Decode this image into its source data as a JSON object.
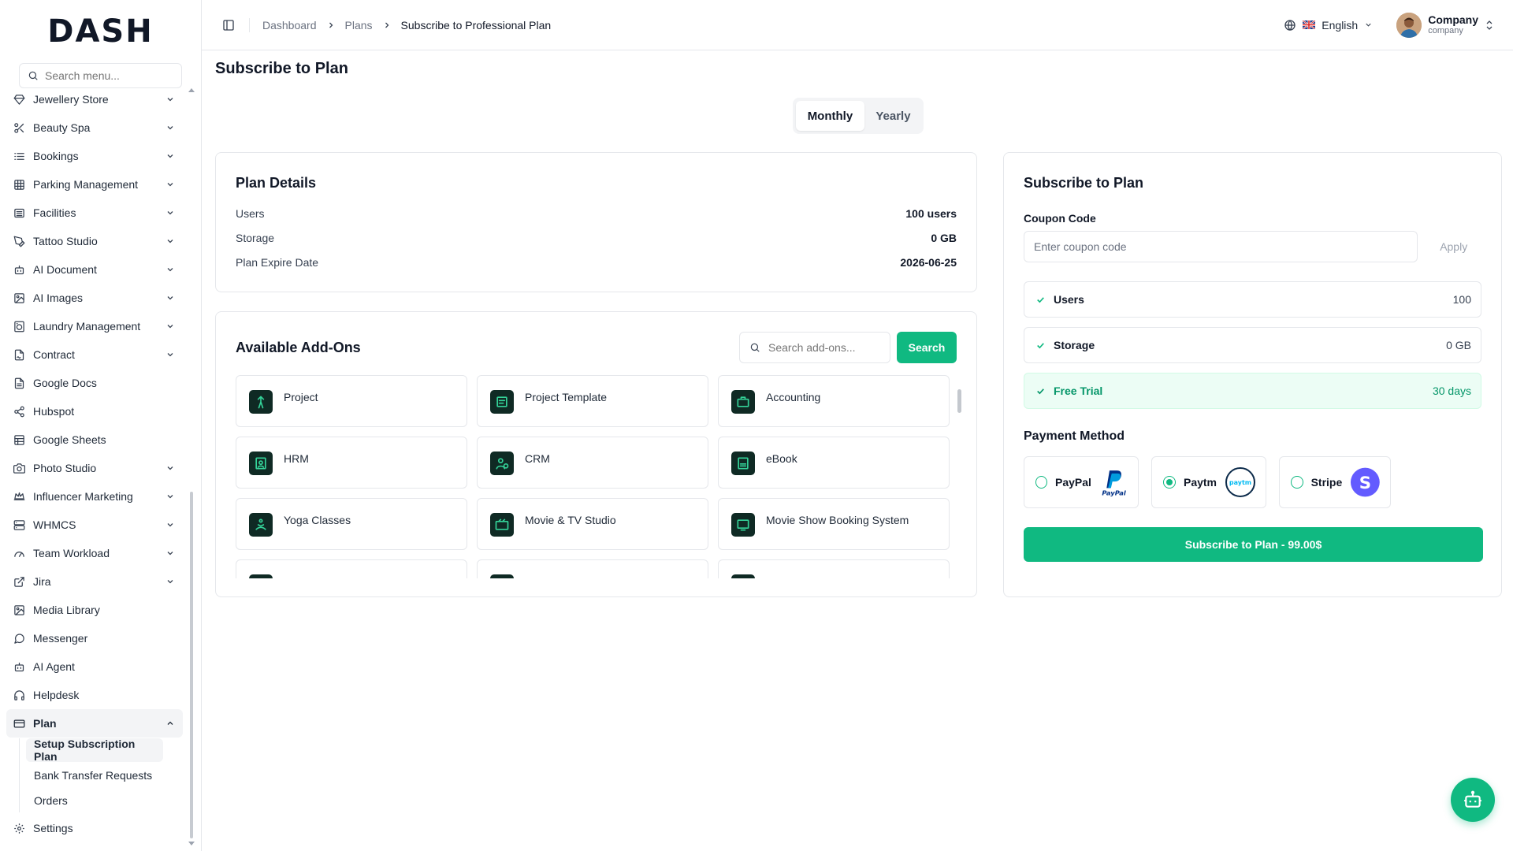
{
  "brand": {
    "logo_text": "DASH"
  },
  "sidebar": {
    "search_placeholder": "Search menu...",
    "items": [
      {
        "label": "Jewellery Store",
        "icon": "gem-icon",
        "expandable": true
      },
      {
        "label": "Beauty Spa",
        "icon": "scissors-icon",
        "expandable": true
      },
      {
        "label": "Bookings",
        "icon": "list-icon",
        "expandable": true
      },
      {
        "label": "Parking Management",
        "icon": "grid-icon",
        "expandable": true
      },
      {
        "label": "Facilities",
        "icon": "building-icon",
        "expandable": true
      },
      {
        "label": "Tattoo Studio",
        "icon": "pen-tool-icon",
        "expandable": true
      },
      {
        "label": "AI Document",
        "icon": "bot-icon",
        "expandable": true
      },
      {
        "label": "AI Images",
        "icon": "image-icon",
        "expandable": true
      },
      {
        "label": "Laundry Management",
        "icon": "washing-machine-icon",
        "expandable": true
      },
      {
        "label": "Contract",
        "icon": "file-signature-icon",
        "expandable": true
      },
      {
        "label": "Google Docs",
        "icon": "file-text-icon",
        "expandable": false
      },
      {
        "label": "Hubspot",
        "icon": "share-icon",
        "expandable": false
      },
      {
        "label": "Google Sheets",
        "icon": "sheet-icon",
        "expandable": false
      },
      {
        "label": "Photo Studio",
        "icon": "camera-icon",
        "expandable": true
      },
      {
        "label": "Influencer Marketing",
        "icon": "crown-icon",
        "expandable": true
      },
      {
        "label": "WHMCS",
        "icon": "server-icon",
        "expandable": true
      },
      {
        "label": "Team Workload",
        "icon": "gauge-icon",
        "expandable": true
      },
      {
        "label": "Jira",
        "icon": "external-link-icon",
        "expandable": true
      },
      {
        "label": "Media Library",
        "icon": "image-icon",
        "expandable": false
      },
      {
        "label": "Messenger",
        "icon": "message-circle-icon",
        "expandable": false
      },
      {
        "label": "AI Agent",
        "icon": "bot-icon",
        "expandable": false
      },
      {
        "label": "Helpdesk",
        "icon": "headphones-icon",
        "expandable": false
      }
    ],
    "plan": {
      "label": "Plan",
      "children": [
        "Setup Subscription Plan",
        "Bank Transfer Requests",
        "Orders"
      ]
    },
    "settings_label": "Settings"
  },
  "header": {
    "breadcrumb": [
      "Dashboard",
      "Plans",
      "Subscribe to Professional Plan"
    ],
    "language": "English",
    "user_name": "Company",
    "user_role": "company"
  },
  "page": {
    "title": "Subscribe to Plan",
    "billing": {
      "monthly": "Monthly",
      "yearly": "Yearly",
      "selected": "Monthly"
    }
  },
  "plan_details": {
    "title": "Plan Details",
    "rows": [
      {
        "label": "Users",
        "value": "100 users"
      },
      {
        "label": "Storage",
        "value": "0 GB"
      },
      {
        "label": "Plan Expire Date",
        "value": "2026-06-25"
      }
    ]
  },
  "addons": {
    "title": "Available Add-Ons",
    "search_placeholder": "Search add-ons...",
    "search_button": "Search",
    "items": [
      "Project",
      "Project Template",
      "Accounting",
      "HRM",
      "CRM",
      "eBook",
      "Yoga Classes",
      "Movie & TV Studio",
      "Movie Show Booking System",
      "",
      "",
      ""
    ]
  },
  "subscribe": {
    "title": "Subscribe to Plan",
    "coupon_label": "Coupon Code",
    "coupon_placeholder": "Enter coupon code",
    "apply_label": "Apply",
    "features": [
      {
        "name": "Users",
        "value": "100"
      },
      {
        "name": "Storage",
        "value": "0 GB"
      },
      {
        "name": "Free Trial",
        "value": "30 days"
      }
    ],
    "payment_title": "Payment Method",
    "payment_methods": [
      {
        "name": "PayPal",
        "logo_text": "PayPal",
        "selected": false
      },
      {
        "name": "Paytm",
        "logo_text": "paytm",
        "selected": true
      },
      {
        "name": "Stripe",
        "logo_text": "S",
        "selected": false
      }
    ],
    "submit_label": "Subscribe to Plan - 99.00$"
  },
  "colors": {
    "accent": "#10b981",
    "accent_dark": "#059669",
    "addon_icon_bg": "#0f2a24"
  }
}
